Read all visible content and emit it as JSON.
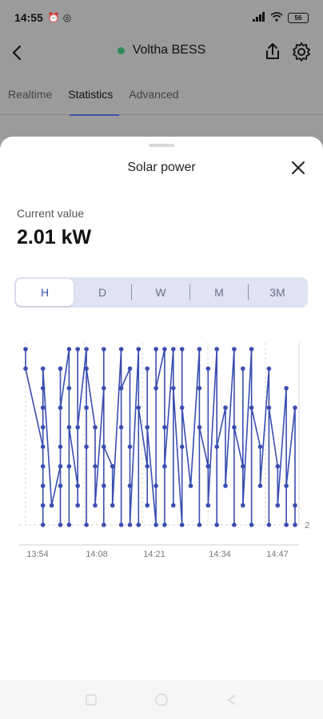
{
  "status_bar": {
    "time": "14:55",
    "battery": "56"
  },
  "header": {
    "title": "Voltha BESS",
    "online": true
  },
  "tabs": [
    {
      "label": "Realtime",
      "active": false
    },
    {
      "label": "Statistics",
      "active": true
    },
    {
      "label": "Advanced",
      "active": false
    }
  ],
  "sheet": {
    "title": "Solar power",
    "current_label": "Current value",
    "current_value": "2.01 kW",
    "ranges": [
      "H",
      "D",
      "W",
      "M",
      "3M"
    ],
    "selected_range": "H"
  },
  "colors": {
    "accent": "#3f53a8",
    "online": "#2e8b57",
    "line": "#3a4db0"
  },
  "chart_data": {
    "type": "line",
    "x_tick_labels": [
      "13:54",
      "14:08",
      "14:21",
      "14:34",
      "14:47"
    ],
    "y_tick_labels": [
      "2"
    ],
    "series": [
      {
        "points": [
          [
            0,
            9
          ],
          [
            0,
            8
          ],
          [
            2,
            4
          ],
          [
            2,
            0
          ],
          [
            2,
            1
          ],
          [
            2,
            2
          ],
          [
            2,
            3
          ],
          [
            2,
            5
          ],
          [
            2,
            6
          ],
          [
            2,
            7
          ],
          [
            2,
            8
          ],
          [
            3,
            1
          ],
          [
            4,
            3
          ],
          [
            4,
            8
          ],
          [
            4,
            0
          ],
          [
            4,
            2
          ],
          [
            4,
            4
          ],
          [
            4,
            6
          ],
          [
            5,
            9
          ],
          [
            5,
            0
          ],
          [
            5,
            3
          ],
          [
            5,
            7
          ],
          [
            5,
            5
          ],
          [
            6,
            2
          ],
          [
            6,
            9
          ],
          [
            6,
            1
          ],
          [
            6,
            5
          ],
          [
            7,
            9
          ],
          [
            7,
            0
          ],
          [
            7,
            4
          ],
          [
            7,
            6
          ],
          [
            7,
            8
          ],
          [
            8,
            5
          ],
          [
            8,
            3
          ],
          [
            8,
            1
          ],
          [
            9,
            7
          ],
          [
            9,
            0
          ],
          [
            9,
            2
          ],
          [
            9,
            9
          ],
          [
            9,
            4
          ],
          [
            10,
            3
          ],
          [
            10,
            1
          ],
          [
            11,
            9
          ],
          [
            11,
            0
          ],
          [
            11,
            5
          ],
          [
            11,
            7
          ],
          [
            12,
            8
          ],
          [
            12,
            4
          ],
          [
            12,
            2
          ],
          [
            12,
            0
          ],
          [
            13,
            9
          ],
          [
            13,
            0
          ],
          [
            13,
            6
          ],
          [
            14,
            3
          ],
          [
            14,
            1
          ],
          [
            14,
            8
          ],
          [
            14,
            5
          ],
          [
            15,
            0
          ],
          [
            15,
            9
          ],
          [
            15,
            2
          ],
          [
            15,
            7
          ],
          [
            16,
            9
          ],
          [
            16,
            0
          ],
          [
            16,
            5
          ],
          [
            16,
            3
          ],
          [
            17,
            9
          ],
          [
            17,
            1
          ],
          [
            17,
            7
          ],
          [
            18,
            0
          ],
          [
            18,
            9
          ],
          [
            18,
            4
          ],
          [
            18,
            6
          ],
          [
            19,
            2
          ],
          [
            20,
            9
          ],
          [
            20,
            0
          ],
          [
            20,
            7
          ],
          [
            20,
            5
          ],
          [
            21,
            3
          ],
          [
            21,
            8
          ],
          [
            21,
            1
          ],
          [
            22,
            9
          ],
          [
            22,
            0
          ],
          [
            22,
            4
          ],
          [
            23,
            6
          ],
          [
            23,
            2
          ],
          [
            24,
            9
          ],
          [
            24,
            0
          ],
          [
            24,
            5
          ],
          [
            25,
            3
          ],
          [
            25,
            8
          ],
          [
            25,
            1
          ],
          [
            26,
            9
          ],
          [
            26,
            0
          ],
          [
            26,
            6
          ],
          [
            27,
            4
          ],
          [
            27,
            2
          ],
          [
            28,
            8
          ],
          [
            28,
            0
          ],
          [
            28,
            6
          ],
          [
            29,
            3
          ],
          [
            29,
            1
          ],
          [
            30,
            7
          ],
          [
            30,
            0
          ],
          [
            30,
            2
          ],
          [
            31,
            6
          ],
          [
            31,
            0
          ],
          [
            31,
            1
          ]
        ]
      }
    ],
    "x_range": [
      0,
      31
    ],
    "y_range": [
      0,
      9
    ],
    "grid": true
  }
}
